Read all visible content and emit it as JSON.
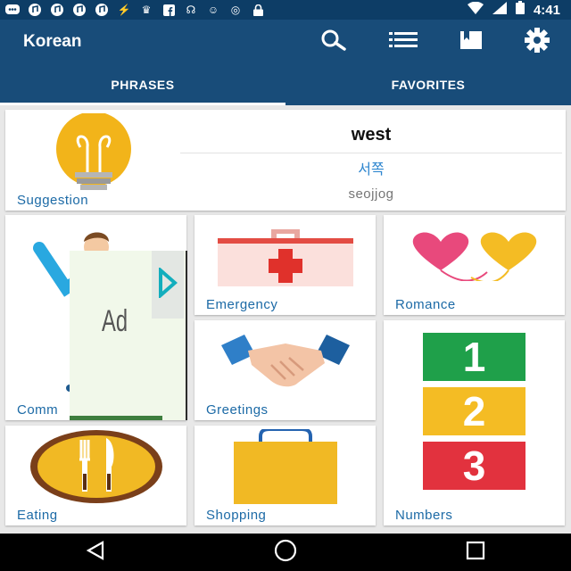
{
  "status": {
    "time": "4:41"
  },
  "app": {
    "title": "Korean"
  },
  "toolbar": {
    "search": "search",
    "list": "list",
    "bookmark": "bookmark",
    "settings": "settings"
  },
  "tabs": [
    {
      "label": "PHRASES",
      "active": true
    },
    {
      "label": "FAVORITES",
      "active": false
    }
  ],
  "suggestion": {
    "label": "Suggestion",
    "english": "west",
    "korean": "서쪽",
    "romanization": "seojjog"
  },
  "categories": [
    {
      "label": "Comm",
      "icon": "person-waving-icon"
    },
    {
      "label": "Emergency",
      "icon": "first-aid-kit-icon"
    },
    {
      "label": "Romance",
      "icon": "hearts-icon"
    },
    {
      "label": "Greetings",
      "icon": "handshake-icon"
    },
    {
      "label": "Numbers",
      "icon": "numbers-icon",
      "digits": [
        "1",
        "2",
        "3"
      ]
    },
    {
      "label": "Eating",
      "icon": "fork-knife-plate-icon"
    },
    {
      "label": "Shopping",
      "icon": "shopping-bag-icon"
    }
  ],
  "ad": {
    "label": "Ad"
  },
  "colors": {
    "appbar": "#184c79",
    "statusbar": "#0d3d66",
    "label": "#1c6aa6",
    "korean": "#2e86cf"
  }
}
